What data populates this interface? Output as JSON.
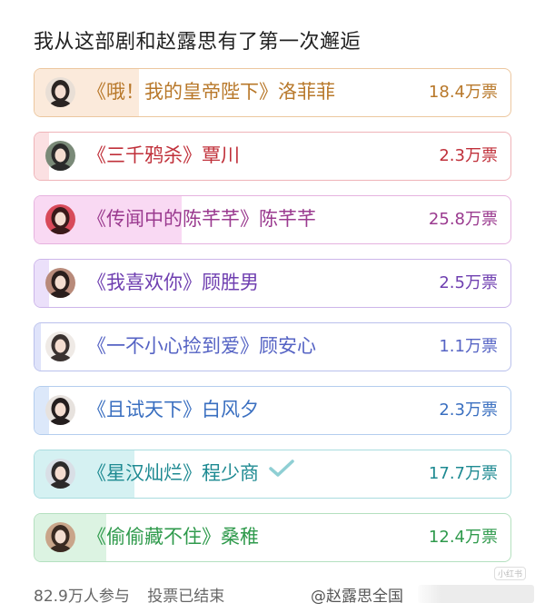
{
  "poll": {
    "title": "我从这部剧和赵露思有了第一次邂逅",
    "options": [
      {
        "label": "《哦！我的皇帝陛下》洛菲菲",
        "votes": "18.4万票",
        "fraction": 0.22,
        "text_color": "#b8782a",
        "border_color": "#ecc79f",
        "fill_color": "#fbeadb",
        "avatar_bg": "#e9dfd6",
        "avatar_fg": "#2a2422"
      },
      {
        "label": "《三千鸦杀》覃川",
        "votes": "2.3万票",
        "fraction": 0.03,
        "text_color": "#c0303a",
        "border_color": "#efb3b8",
        "fill_color": "#fbe0e2",
        "avatar_bg": "#7a8a78",
        "avatar_fg": "#2b2b2b"
      },
      {
        "label": "《传闻中的陈芊芊》陈芊芊",
        "votes": "25.8万票",
        "fraction": 0.31,
        "text_color": "#9a3a8f",
        "border_color": "#e6b2df",
        "fill_color": "#f9d9f3",
        "avatar_bg": "#d84a5a",
        "avatar_fg": "#3a1a1a"
      },
      {
        "label": "《我喜欢你》顾胜男",
        "votes": "2.5万票",
        "fraction": 0.03,
        "text_color": "#6f3fb0",
        "border_color": "#ccb5ea",
        "fill_color": "#ebe0fa",
        "avatar_bg": "#b88a7a",
        "avatar_fg": "#2a1e1c"
      },
      {
        "label": "《一不小心捡到爱》顾安心",
        "votes": "1.1万票",
        "fraction": 0.014,
        "text_color": "#5563c4",
        "border_color": "#b9c0ec",
        "fill_color": "#dfe3fa",
        "avatar_bg": "#efeae6",
        "avatar_fg": "#3a3230"
      },
      {
        "label": "《且试天下》白风夕",
        "votes": "2.3万票",
        "fraction": 0.03,
        "text_color": "#3a6fc0",
        "border_color": "#b4cdee",
        "fill_color": "#dce8fa",
        "avatar_bg": "#e7e2de",
        "avatar_fg": "#241e1e"
      },
      {
        "label": "《星汉灿烂》程少商",
        "votes": "17.7万票",
        "fraction": 0.21,
        "text_color": "#1e8a92",
        "border_color": "#a9dcdf",
        "fill_color": "#d5f1f2",
        "avatar_bg": "#d9dfe6",
        "avatar_fg": "#2c2a2a",
        "checked": true
      },
      {
        "label": "《偷偷藏不住》桑稚",
        "votes": "12.4万票",
        "fraction": 0.15,
        "text_color": "#2f9a4c",
        "border_color": "#b4e0bf",
        "fill_color": "#dcf3e2",
        "avatar_bg": "#c9a58a",
        "avatar_fg": "#3a2a22"
      }
    ],
    "check_icon": "checkmark-icon",
    "check_color": "#8fcfd4"
  },
  "footer": {
    "participants": "82.9万人参与",
    "status": "投票已结束",
    "source": "@赵露思全国"
  },
  "watermark": {
    "badge": "小红书"
  }
}
